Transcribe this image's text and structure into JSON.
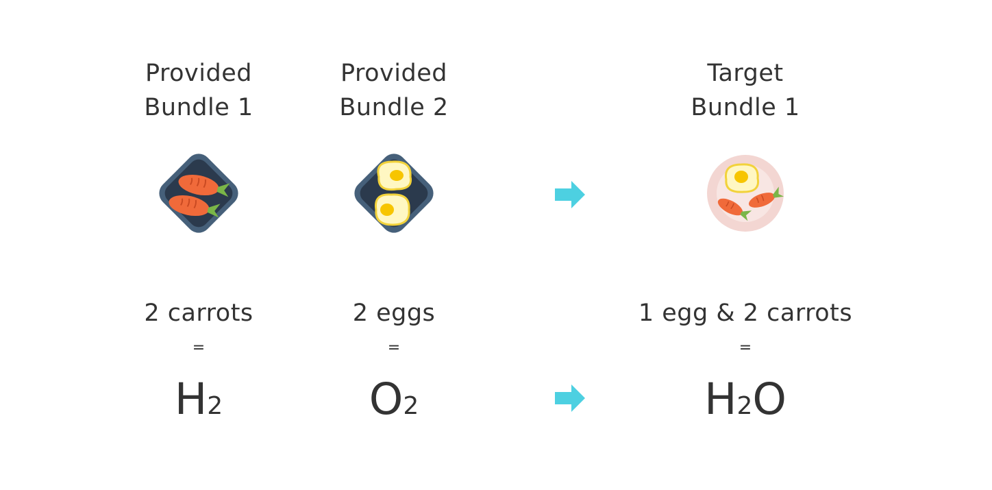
{
  "columns": [
    {
      "title_line1": "Provided",
      "title_line2": "Bundle 1",
      "icon": "tray-with-carrots",
      "caption": "2 carrots",
      "equals": "=",
      "formula_main": "H",
      "formula_sub": "2",
      "formula_tail": ""
    },
    {
      "title_line1": "Provided",
      "title_line2": "Bundle 2",
      "icon": "tray-with-eggs",
      "caption": "2 eggs",
      "equals": "=",
      "formula_main": "O",
      "formula_sub": "2",
      "formula_tail": ""
    },
    {
      "title_line1": "Target",
      "title_line2": "Bundle 1",
      "icon": "plate-with-egg-and-carrots",
      "caption": "1 egg & 2 carrots",
      "equals": "=",
      "formula_main": "H",
      "formula_sub": "2",
      "formula_tail": "O"
    }
  ],
  "arrows": [
    "arrow-right-icon",
    "arrow-right-icon"
  ],
  "colors": {
    "text": "#333333",
    "arrow": "#4dd0e1",
    "tray_outer": "#46607a",
    "tray_inner": "#2b3a4d",
    "carrot": "#f06a3a",
    "carrot_leaf": "#7ab648",
    "egg_white": "#fff7c2",
    "egg_outline": "#f2d23a",
    "egg_yolk": "#f7c500",
    "plate_outer": "#f3d6d2",
    "plate_inner": "#f8e6e3"
  }
}
